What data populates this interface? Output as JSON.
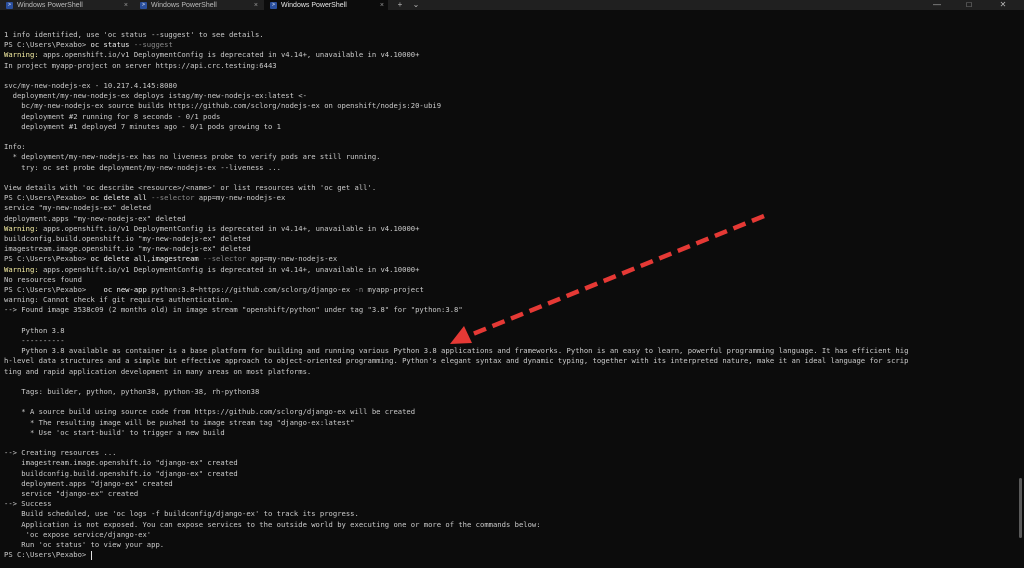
{
  "tabs": [
    {
      "title": "Windows PowerShell",
      "active": false
    },
    {
      "title": "Windows PowerShell",
      "active": false
    },
    {
      "title": "Windows PowerShell",
      "active": true
    }
  ],
  "tab_close_glyph": "×",
  "new_tab_glyph": "+",
  "dropdown_glyph": "⌄",
  "window_controls": {
    "minimize": "—",
    "maximize": "□",
    "close": "✕"
  },
  "terminal": {
    "lines": [
      [
        {
          "t": "1 info identified, use 'oc status --suggest' to see details."
        }
      ],
      [
        {
          "t": "PS C:\\Users\\Pexabo> "
        },
        {
          "t": "oc status",
          "c": "cmd"
        },
        {
          "t": " --suggest",
          "c": "param"
        }
      ],
      [
        {
          "t": "Warning:",
          "c": "warn"
        },
        {
          "t": " apps.openshift.io/v1 DeploymentConfig is deprecated in v4.14+, unavailable in v4.10000+"
        }
      ],
      [
        {
          "t": "In project myapp-project on server https://api.crc.testing:6443"
        }
      ],
      [],
      [
        {
          "t": "svc/my-new-nodejs-ex - 10.217.4.145:8080"
        }
      ],
      [
        {
          "t": "  deployment/my-new-nodejs-ex deploys istag/my-new-nodejs-ex:latest <-"
        }
      ],
      [
        {
          "t": "    bc/my-new-nodejs-ex source builds https://github.com/sclorg/nodejs-ex on openshift/nodejs:20-ubi9"
        }
      ],
      [
        {
          "t": "    deployment #2 running for 8 seconds - 0/1 pods"
        }
      ],
      [
        {
          "t": "    deployment #1 deployed 7 minutes ago - 0/1 pods growing to 1"
        }
      ],
      [],
      [
        {
          "t": "Info:"
        }
      ],
      [
        {
          "t": "  * deployment/my-new-nodejs-ex has no liveness probe to verify pods are still running."
        }
      ],
      [
        {
          "t": "    try: oc set probe deployment/my-new-nodejs-ex --liveness ..."
        }
      ],
      [],
      [
        {
          "t": "View details with 'oc describe <resource>/<name>' or list resources with 'oc get all'."
        }
      ],
      [
        {
          "t": "PS C:\\Users\\Pexabo> "
        },
        {
          "t": "oc delete all",
          "c": "cmd"
        },
        {
          "t": " --selector",
          "c": "param"
        },
        {
          "t": " app=my-new-nodejs-ex"
        }
      ],
      [
        {
          "t": "service \"my-new-nodejs-ex\" deleted"
        }
      ],
      [
        {
          "t": "deployment.apps \"my-new-nodejs-ex\" deleted"
        }
      ],
      [
        {
          "t": "Warning:",
          "c": "warn"
        },
        {
          "t": " apps.openshift.io/v1 DeploymentConfig is deprecated in v4.14+, unavailable in v4.10000+"
        }
      ],
      [
        {
          "t": "buildconfig.build.openshift.io \"my-new-nodejs-ex\" deleted"
        }
      ],
      [
        {
          "t": "imagestream.image.openshift.io \"my-new-nodejs-ex\" deleted"
        }
      ],
      [
        {
          "t": "PS C:\\Users\\Pexabo> "
        },
        {
          "t": "oc delete all,imagestream",
          "c": "cmd"
        },
        {
          "t": " --selector",
          "c": "param"
        },
        {
          "t": " app=my-new-nodejs-ex"
        }
      ],
      [
        {
          "t": "Warning:",
          "c": "warn"
        },
        {
          "t": " apps.openshift.io/v1 DeploymentConfig is deprecated in v4.14+, unavailable in v4.10000+"
        }
      ],
      [
        {
          "t": "No resources found"
        }
      ],
      [
        {
          "t": "PS C:\\Users\\Pexabo>    "
        },
        {
          "t": "oc new-app",
          "c": "cmd"
        },
        {
          "t": " python:3.8~https://github.com/sclorg/django-ex"
        },
        {
          "t": " -n",
          "c": "param"
        },
        {
          "t": " myapp-project"
        }
      ],
      [
        {
          "t": "warning: Cannot check if git requires authentication."
        }
      ],
      [
        {
          "t": "--> Found image 3538c09 (2 months old) in image stream \"openshift/python\" under tag \"3.8\" for \"python:3.8\""
        }
      ],
      [],
      [
        {
          "t": "    Python 3.8"
        }
      ],
      [
        {
          "t": "    ----------"
        }
      ],
      [
        {
          "t": "    Python 3.8 available as container is a base platform for building and running various Python 3.8 applications and frameworks. Python is an easy to learn, powerful programming language. It has efficient hig"
        }
      ],
      [
        {
          "t": "h-level data structures and a simple but effective approach to object-oriented programming. Python's elegant syntax and dynamic typing, together with its interpreted nature, make it an ideal language for scrip"
        }
      ],
      [
        {
          "t": "ting and rapid application development in many areas on most platforms."
        }
      ],
      [],
      [
        {
          "t": "    Tags: builder, python, python38, python-38, rh-python38"
        }
      ],
      [],
      [
        {
          "t": "    * A source build using source code from https://github.com/sclorg/django-ex will be created"
        }
      ],
      [
        {
          "t": "      * The resulting image will be pushed to image stream tag \"django-ex:latest\""
        }
      ],
      [
        {
          "t": "      * Use 'oc start-build' to trigger a new build"
        }
      ],
      [],
      [
        {
          "t": "--> Creating resources ..."
        }
      ],
      [
        {
          "t": "    imagestream.image.openshift.io \"django-ex\" created"
        }
      ],
      [
        {
          "t": "    buildconfig.build.openshift.io \"django-ex\" created"
        }
      ],
      [
        {
          "t": "    deployment.apps \"django-ex\" created"
        }
      ],
      [
        {
          "t": "    service \"django-ex\" created"
        }
      ],
      [
        {
          "t": "--> Success"
        }
      ],
      [
        {
          "t": "    Build scheduled, use 'oc logs -f buildconfig/django-ex' to track its progress."
        }
      ],
      [
        {
          "t": "    Application is not exposed. You can expose services to the outside world by executing one or more of the commands below:"
        }
      ],
      [
        {
          "t": "     'oc expose service/django-ex'"
        }
      ],
      [
        {
          "t": "    Run 'oc status' to view your app."
        }
      ],
      [
        {
          "t": "PS C:\\Users\\Pexabo> "
        },
        {
          "cursor": true
        }
      ]
    ]
  },
  "annotation": {
    "color": "#e53935",
    "style": "dashed"
  }
}
